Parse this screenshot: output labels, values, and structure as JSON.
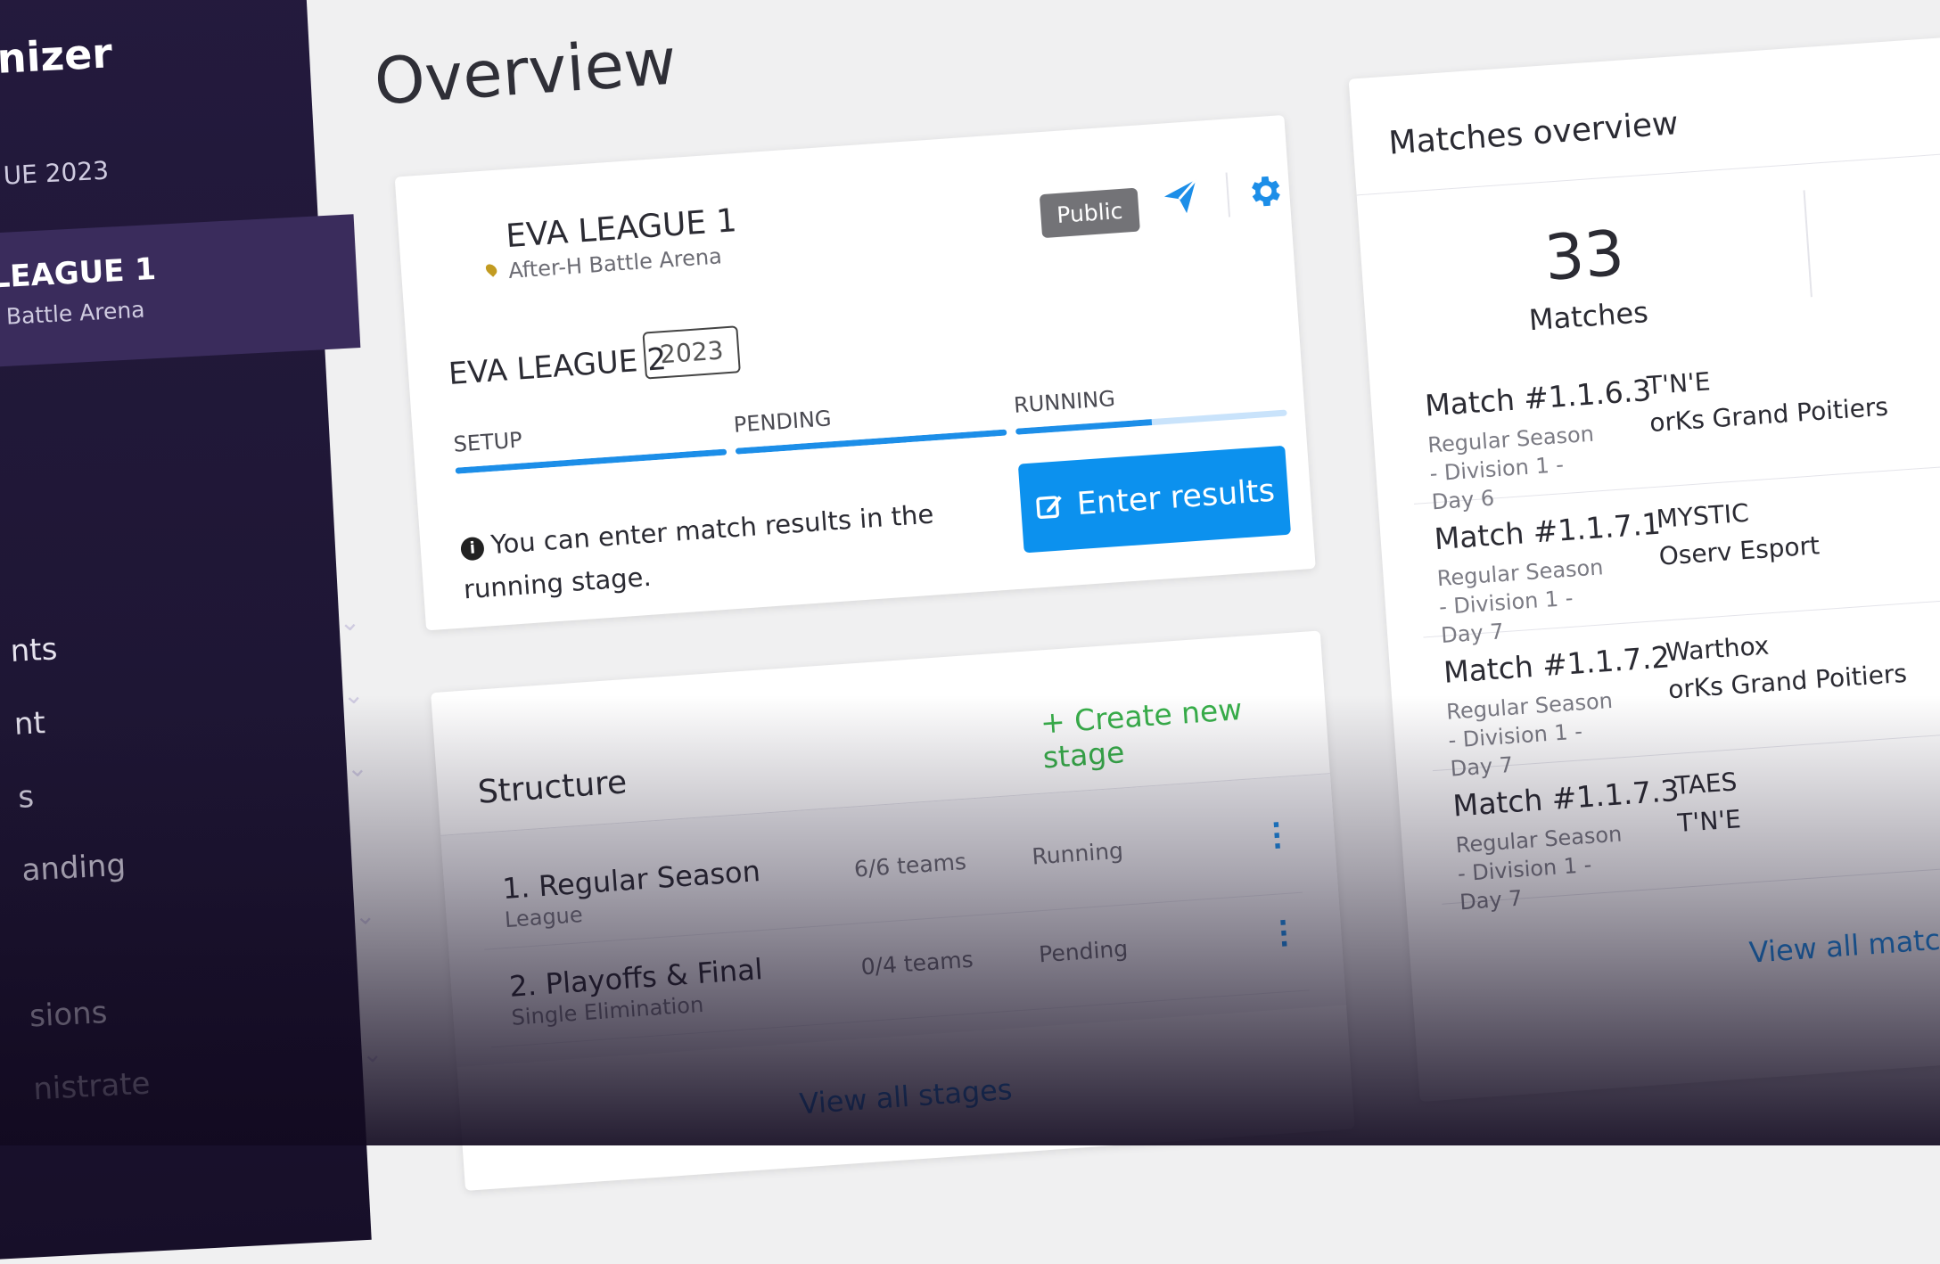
{
  "sidebar": {
    "brand": "nizer",
    "season": "UE 2023",
    "active": {
      "title": "LEAGUE 1",
      "subtitle": "l Battle Arena"
    },
    "items": [
      {
        "label": "nts"
      },
      {
        "label": "nt"
      },
      {
        "label": "s"
      },
      {
        "label": "anding"
      },
      {
        "label": ""
      },
      {
        "label": "sions"
      },
      {
        "label": "nistrate"
      }
    ]
  },
  "page": {
    "title": "Overview"
  },
  "tournament": {
    "name": "EVA LEAGUE 1",
    "place": "After-H Battle Arena",
    "visibility": "Public",
    "stage_name": "EVA LEAGUE 2",
    "year": "2023",
    "phases": [
      {
        "label": "SETUP",
        "progress": 1.0
      },
      {
        "label": "PENDING",
        "progress": 1.0
      },
      {
        "label": "RUNNING",
        "progress": 0.5
      }
    ],
    "info": "You can enter match results in the running stage.",
    "enter_results": "Enter results",
    "icons": {
      "send": "send-icon",
      "settings": "gear-icon",
      "location": "location-icon",
      "info": "info-icon",
      "edit": "edit-icon"
    },
    "accent": "#0c91ee"
  },
  "structure": {
    "title": "Structure",
    "create": "Create new stage",
    "stages": [
      {
        "name": "1. Regular Season",
        "type": "League",
        "teams": "6/6 teams",
        "status": "Running"
      },
      {
        "name": "2. Playoffs & Final",
        "type": "Single Elimination",
        "teams": "0/4 teams",
        "status": "Pending"
      }
    ],
    "view_all": "View all stages"
  },
  "matches": {
    "title": "Matches overview",
    "count": "33",
    "count_label": "Matches",
    "items": [
      {
        "id": "Match #1.1.6.3",
        "desc": "Regular Season - Division 1 - Day 6",
        "team1": "T'N'E",
        "team2": "orKs Grand Poitiers"
      },
      {
        "id": "Match #1.1.7.1",
        "desc": "Regular Season - Division 1 - Day 7",
        "team1": "MYSTIC",
        "team2": "Oserv Esport"
      },
      {
        "id": "Match #1.1.7.2",
        "desc": "Regular Season - Division 1 - Day 7",
        "team1": "Warthox",
        "team2": "orKs Grand Poitiers"
      },
      {
        "id": "Match #1.1.7.3",
        "desc": "Regular Season - Division 1 - Day 7",
        "team1": "TAES",
        "team2": "T'N'E"
      }
    ],
    "view_all": "View all match"
  }
}
